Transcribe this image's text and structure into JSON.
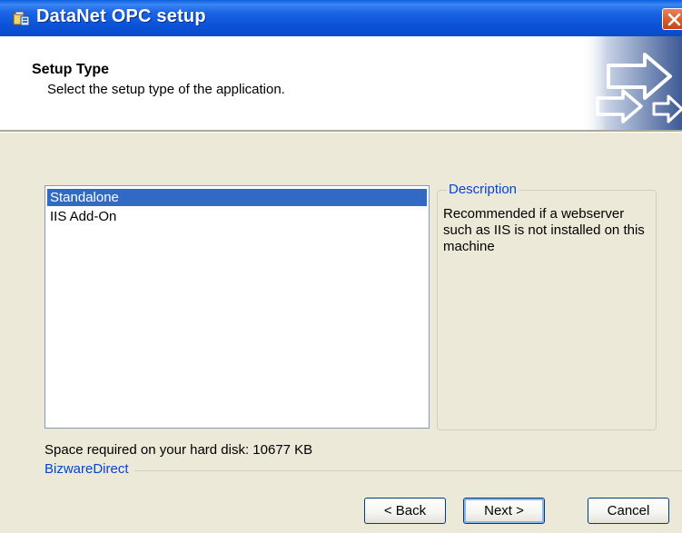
{
  "window": {
    "title": "DataNet OPC setup"
  },
  "header": {
    "title": "Setup Type",
    "subtitle": "Select the setup type of the application."
  },
  "setup_types": {
    "items": [
      {
        "label": "Standalone",
        "selected": true
      },
      {
        "label": "IIS Add-On",
        "selected": false
      }
    ]
  },
  "description": {
    "legend": "Description",
    "text": "Recommended if a webserver such as IIS is not installed on this machine"
  },
  "disk": {
    "text": "Space required on your hard disk: 10677 KB"
  },
  "branding": {
    "label": "BizwareDirect"
  },
  "buttons": {
    "back": "< Back",
    "next": "Next >",
    "cancel": "Cancel"
  },
  "icons": {
    "app": "setup-package-icon",
    "close": "close-icon",
    "banner": "arrows-graphic"
  },
  "colors": {
    "titlebar": "#0a52d8",
    "selection": "#316ac5",
    "group_label": "#0046d5",
    "dialog_bg": "#ece9d8"
  }
}
